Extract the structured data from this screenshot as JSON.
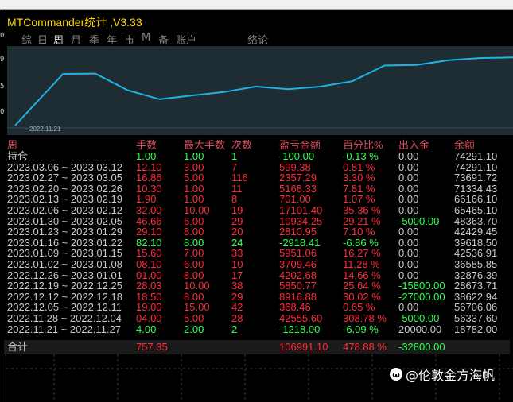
{
  "window": {
    "title": "MTCommander统计 ,V3.33",
    "tabs": [
      "综",
      "日",
      "周",
      "月",
      "季",
      "年",
      "市",
      "M",
      "备",
      "账户",
      "络论"
    ],
    "active_tab": "周"
  },
  "chart_data": {
    "type": "line",
    "x_first_label": "2022.11.21",
    "x": [
      "2022.11.21",
      "2022.11.28",
      "2022.12.05",
      "2022.12.12",
      "2022.12.19",
      "2022.12.26",
      "2023.01.02",
      "2023.01.09",
      "2023.01.16",
      "2023.01.23",
      "2023.01.30",
      "2023.02.06",
      "2023.02.13",
      "2023.02.20",
      "2023.02.27",
      "2023.03.06"
    ],
    "series": [
      {
        "values": [
          18782.0,
          56337.6,
          56706.06,
          38622.94,
          28673.71,
          32876.39,
          36585.85,
          42536.91,
          39618.5,
          42429.45,
          48363.7,
          65465.1,
          66166.1,
          71334.43,
          73691.72,
          74291.1
        ]
      }
    ],
    "line_color": "#1fb2e6"
  },
  "table": {
    "headers": {
      "week": "周",
      "lots": "手数",
      "max_lots": "最大手数",
      "count": "次数",
      "pnl": "盈亏金额",
      "pct": "百分比%",
      "deposit": "出入金",
      "balance": "余额"
    },
    "rows": [
      {
        "week": "持仓",
        "lots": "1.00",
        "max_lots": "1.00",
        "count": "1",
        "pnl": "-100.00",
        "pct": "-0.13 %",
        "deposit": "0.00",
        "balance": "74291.10",
        "color": "grn"
      },
      {
        "week": "2023.03.06 ~ 2023.03.12",
        "lots": "12.10",
        "max_lots": "3.00",
        "count": "7",
        "pnl": "599.38",
        "pct": "0.81 %",
        "deposit": "0.00",
        "balance": "74291.10",
        "color": "red"
      },
      {
        "week": "2023.02.27 ~ 2023.03.05",
        "lots": "16.86",
        "max_lots": "5.00",
        "count": "116",
        "pnl": "2357.29",
        "pct": "3.30 %",
        "deposit": "0.00",
        "balance": "73691.72",
        "color": "red"
      },
      {
        "week": "2023.02.20 ~ 2023.02.26",
        "lots": "10.30",
        "max_lots": "1.00",
        "count": "11",
        "pnl": "5168.33",
        "pct": "7.81 %",
        "deposit": "0.00",
        "balance": "71334.43",
        "color": "red"
      },
      {
        "week": "2023.02.13 ~ 2023.02.19",
        "lots": "1.90",
        "max_lots": "1.00",
        "count": "8",
        "pnl": "701.00",
        "pct": "1.07 %",
        "deposit": "0.00",
        "balance": "66166.10",
        "color": "red"
      },
      {
        "week": "2023.02.06 ~ 2023.02.12",
        "lots": "32.00",
        "max_lots": "10.00",
        "count": "19",
        "pnl": "17101.40",
        "pct": "35.36 %",
        "deposit": "0.00",
        "balance": "65465.10",
        "color": "red"
      },
      {
        "week": "2023.01.30 ~ 2023.02.05",
        "lots": "46.66",
        "max_lots": "6.00",
        "count": "29",
        "pnl": "10934.25",
        "pct": "29.21 %",
        "deposit": "-5000.00",
        "balance": "48363.70",
        "color": "red"
      },
      {
        "week": "2023.01.23 ~ 2023.01.29",
        "lots": "29.10",
        "max_lots": "8.00",
        "count": "20",
        "pnl": "2810.95",
        "pct": "7.10 %",
        "deposit": "0.00",
        "balance": "42429.45",
        "color": "red"
      },
      {
        "week": "2023.01.16 ~ 2023.01.22",
        "lots": "82.10",
        "max_lots": "8.00",
        "count": "24",
        "pnl": "-2918.41",
        "pct": "-6.86 %",
        "deposit": "0.00",
        "balance": "39618.50",
        "color": "grn"
      },
      {
        "week": "2023.01.09 ~ 2023.01.15",
        "lots": "15.60",
        "max_lots": "7.00",
        "count": "33",
        "pnl": "5951.06",
        "pct": "16.27 %",
        "deposit": "0.00",
        "balance": "42536.91",
        "color": "red"
      },
      {
        "week": "2023.01.02 ~ 2023.01.08",
        "lots": "08.10",
        "max_lots": "6.00",
        "count": "10",
        "pnl": "3709.46",
        "pct": "11.28 %",
        "deposit": "0.00",
        "balance": "36585.85",
        "color": "red"
      },
      {
        "week": "2022.12.26 ~ 2023.01.01",
        "lots": "01.00",
        "max_lots": "8.00",
        "count": "17",
        "pnl": "4202.68",
        "pct": "14.66 %",
        "deposit": "0.00",
        "balance": "32876.39",
        "color": "red"
      },
      {
        "week": "2022.12.19 ~ 2022.12.25",
        "lots": "28.03",
        "max_lots": "10.00",
        "count": "38",
        "pnl": "5850.77",
        "pct": "25.64 %",
        "deposit": "-15800.00",
        "balance": "28673.71",
        "color": "red"
      },
      {
        "week": "2022.12.12 ~ 2022.12.18",
        "lots": "18.50",
        "max_lots": "8.00",
        "count": "29",
        "pnl": "8916.88",
        "pct": "30.02 %",
        "deposit": "-27000.00",
        "balance": "38622.94",
        "color": "red"
      },
      {
        "week": "2022.12.05 ~ 2022.12.11",
        "lots": "19.00",
        "max_lots": "15.00",
        "count": "42",
        "pnl": "368.46",
        "pct": "0.65 %",
        "deposit": "0.00",
        "balance": "56706.06",
        "color": "red"
      },
      {
        "week": "2022.11.28 ~ 2022.12.04",
        "lots": "04.00",
        "max_lots": "5.00",
        "count": "28",
        "pnl": "42555.60",
        "pct": "308.78 %",
        "deposit": "-5000.00",
        "balance": "56337.60",
        "color": "red"
      },
      {
        "week": "2022.11.21 ~ 2022.11.27",
        "lots": "4.00",
        "max_lots": "2.00",
        "count": "2",
        "pnl": "-1218.00",
        "pct": "-6.09 %",
        "deposit": "20000.00",
        "balance": "18782.00",
        "color": "grn"
      }
    ],
    "total": {
      "label": "合计",
      "lots": "757.35",
      "pnl": "106991.10",
      "pct": "478.88 %",
      "deposit": "-32800.00"
    }
  },
  "watermark": {
    "text": "@伦敦金方海帆",
    "icon": "weibo-icon"
  },
  "left_axis_ticks": [
    "0",
    "9",
    "5",
    "0"
  ]
}
